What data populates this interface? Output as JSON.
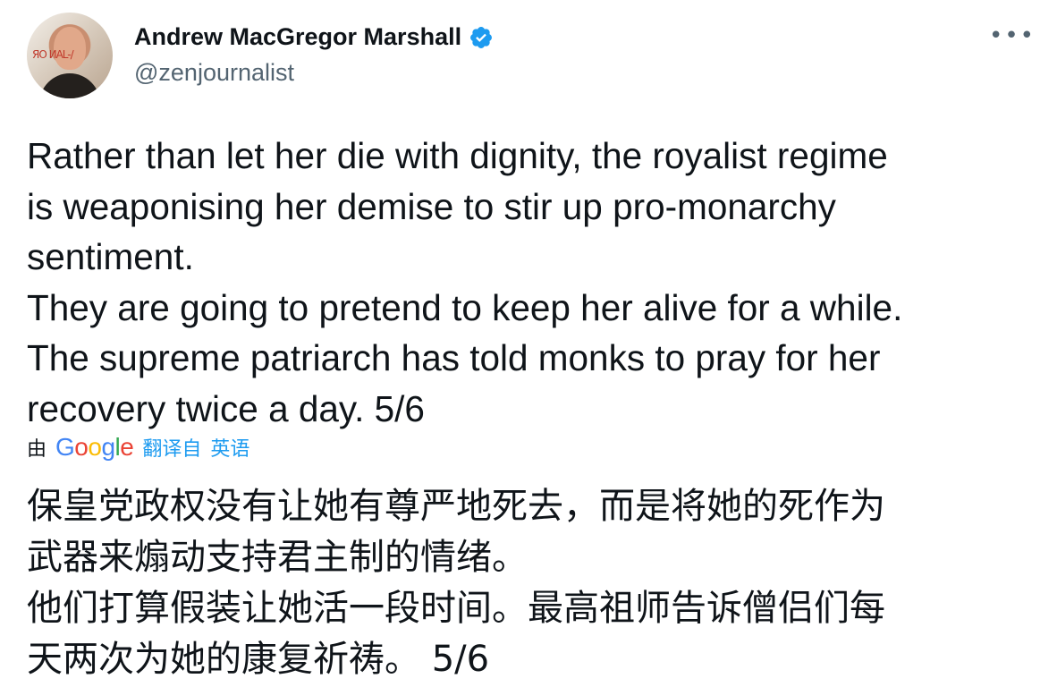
{
  "author": {
    "display_name": "Andrew MacGregor Marshall",
    "handle": "@zenjournalist",
    "verified": true,
    "avatar_text": "ЯО ИAL-/"
  },
  "tweet": {
    "lines": [
      "Rather than let her die with dignity, the royalist regime",
      "is weaponising her demise to stir up pro-monarchy",
      "sentiment.",
      "They are going to pretend to keep her alive for a while.",
      "The supreme patriarch has told monks to pray for her",
      "recovery twice a day. 5/6"
    ]
  },
  "translation": {
    "by_label": "由",
    "provider": "Google",
    "action_label": "翻译自",
    "source_language": "英语",
    "lines": [
      "保皇党政权没有让她有尊严地死去，而是将她的死作为",
      "武器来煽动支持君主制的情绪。",
      "他们打算假装让她活一段时间。最高祖师告诉僧侣们每",
      "天两次为她的康复祈祷。 5/6"
    ]
  },
  "icons": {
    "more": "more-horizontal-icon",
    "verified": "verified-badge-icon"
  },
  "colors": {
    "text": "#0f1419",
    "secondary": "#536471",
    "link": "#1d9bf0",
    "verified": "#1d9bf0"
  }
}
